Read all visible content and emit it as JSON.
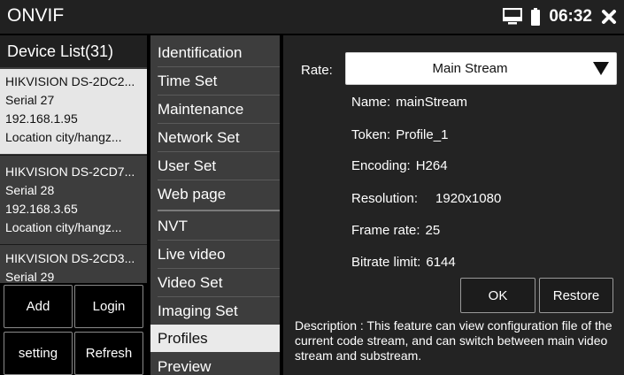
{
  "titlebar": {
    "title": "ONVIF",
    "time": "06:32",
    "icons": [
      "monitor-icon",
      "battery-icon",
      "close-icon"
    ]
  },
  "device_list": {
    "header": "Device List(31)",
    "devices": [
      {
        "name": "HIKVISION DS-2DC2...",
        "serial": "Serial 27",
        "ip": "192.168.1.95",
        "location": "Location city/hangz..."
      },
      {
        "name": "HIKVISION DS-2CD7...",
        "serial": "Serial 28",
        "ip": "192.168.3.65",
        "location": "Location city/hangz..."
      },
      {
        "name": "HIKVISION DS-2CD3...",
        "serial": "Serial 29"
      }
    ],
    "selected_index": 0,
    "buttons": {
      "add": "Add",
      "login": "Login",
      "setting": "setting",
      "refresh": "Refresh"
    }
  },
  "menu": {
    "items": [
      "Identification",
      "Time Set",
      "Maintenance",
      "Network Set",
      "User Set",
      "Web page",
      "NVT",
      "Live video",
      "Video Set",
      "Imaging Set",
      "Profiles",
      "Preview"
    ],
    "active": "Profiles"
  },
  "profile": {
    "rate_label": "Rate:",
    "rate_value": "Main Stream",
    "fields": {
      "name": {
        "label": "Name:",
        "value": "mainStream"
      },
      "token": {
        "label": "Token:",
        "value": "Profile_1"
      },
      "encoding": {
        "label": "Encoding:",
        "value": "H264"
      },
      "resolution": {
        "label": "Resolution:",
        "value": "1920x1080"
      },
      "frame_rate": {
        "label": "Frame rate:",
        "value": "25"
      },
      "bitrate": {
        "label": "Bitrate limit:",
        "value": "6144"
      }
    },
    "ok_label": "OK",
    "restore_label": "Restore",
    "description": "Description : This feature can view configuration file of the current code stream, and can switch between main video stream and substream."
  },
  "colors": {
    "titlebar_bg": "#212121",
    "panel_bg": "#3d3d3d",
    "detail_bg": "#232323",
    "selected_bg": "#e6e6e6"
  }
}
